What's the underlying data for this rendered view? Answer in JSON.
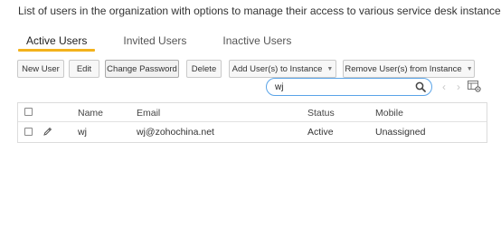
{
  "description": "List of users in the organization with options to manage their access to various service desk instances.",
  "tabs": [
    {
      "label": "Active Users",
      "active": true
    },
    {
      "label": "Invited Users",
      "active": false
    },
    {
      "label": "Inactive Users",
      "active": false
    }
  ],
  "toolbar": {
    "new_user": "New User",
    "edit": "Edit",
    "change_password": "Change Password",
    "delete": "Delete",
    "add_users_to_instance": "Add User(s) to Instance",
    "remove_users_from_instance": "Remove User(s) from Instance"
  },
  "search": {
    "value": "wj",
    "icon": "search-icon"
  },
  "navigation": {
    "prev": "‹",
    "next": "›",
    "columns_icon": "column-settings-icon"
  },
  "table": {
    "headers": {
      "name": "Name",
      "email": "Email",
      "status": "Status",
      "mobile": "Mobile"
    },
    "rows": [
      {
        "name": "wj",
        "email": "wj@zohochina.net",
        "status": "Active",
        "mobile": "Unassigned"
      }
    ]
  },
  "colors": {
    "active_tab_underline": "#f3b21c",
    "search_border": "#5aa4e8"
  }
}
